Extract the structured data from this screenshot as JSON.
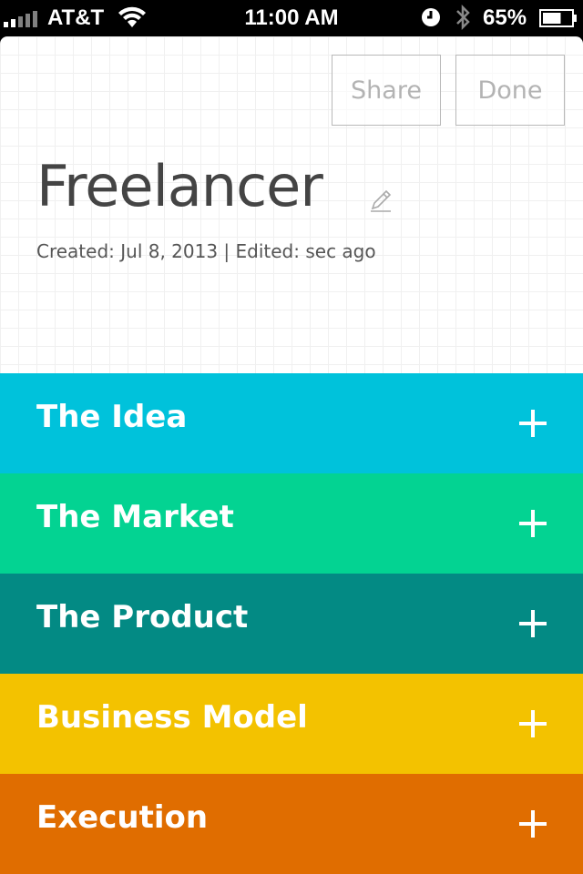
{
  "status_bar": {
    "carrier": "AT&T",
    "time": "11:00 AM",
    "battery_percent": "65%",
    "battery_level": 0.65
  },
  "header": {
    "share_label": "Share",
    "done_label": "Done",
    "title": "Freelancer",
    "meta": "Created: Jul 8, 2013 | Edited: sec ago"
  },
  "sections": [
    {
      "label": "The Idea",
      "color": "#00c2db"
    },
    {
      "label": "The Market",
      "color": "#03d392"
    },
    {
      "label": "The Product",
      "color": "#038a84"
    },
    {
      "label": "Business Model",
      "color": "#f3c200"
    },
    {
      "label": "Execution",
      "color": "#e06d00"
    }
  ]
}
